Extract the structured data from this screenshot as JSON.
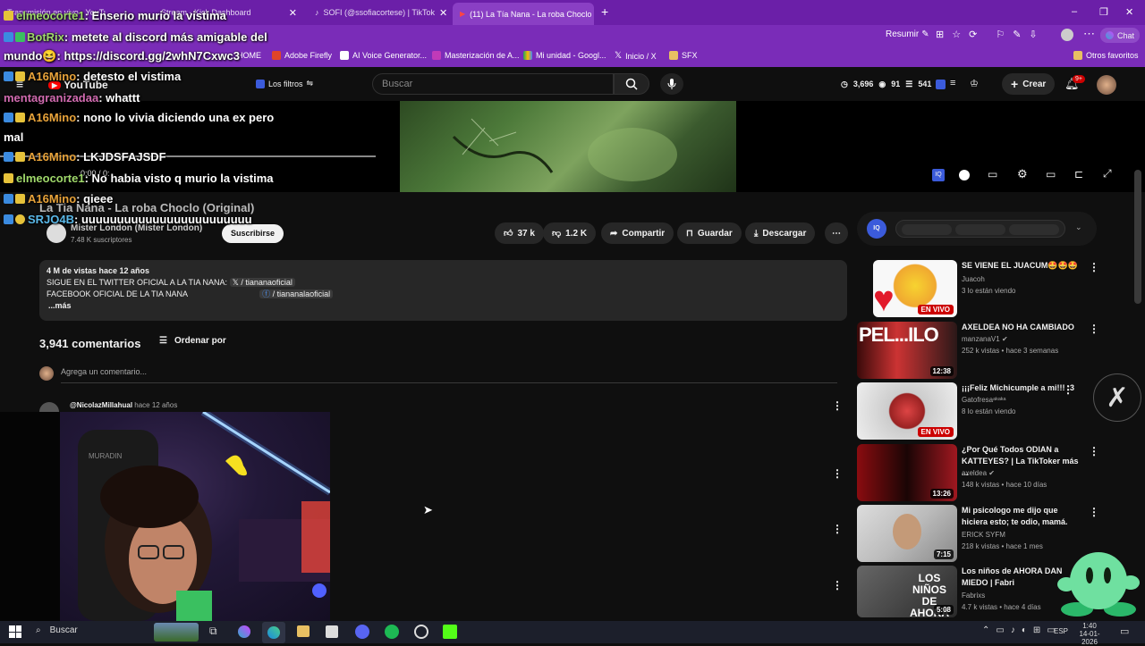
{
  "browser": {
    "tabs": [
      {
        "label": "Transmisión en vivo · YouTube St"
      },
      {
        "label": "Stream - Kick Dashboard"
      },
      {
        "label": "SOFI (@ssofiacortese) | TikTok"
      },
      {
        "label": "(11) La Tía Nana - La roba Choclo",
        "active": true
      }
    ],
    "new_tab": "+",
    "window_controls": [
      "–",
      "❐",
      "✕"
    ],
    "address_right": {
      "resume": "Resumir",
      "chat": "Chat"
    },
    "bookmarks": [
      "HOME",
      "Adobe Firefly",
      "AI Voice Generator...",
      "Masterización de A...",
      "Mi unidad - Googl...",
      "Inicio / X",
      "SFX"
    ],
    "other_bookmarks": "Otros favoritos"
  },
  "youtube": {
    "logo": "YouTube",
    "filters": "Los filtros",
    "search_placeholder": "Buscar",
    "stats": {
      "a": "3,696",
      "b": "91",
      "c": "541"
    },
    "create": "Crear",
    "notifications": "9+",
    "video_title": "La Tia Nana - La roba Choclo (Original)",
    "time": "0:00 / 0:",
    "channel": {
      "name": "Mister London (Mister London)",
      "subs": "7.48 K suscriptores",
      "subscribe": "Suscribirse"
    },
    "actions": {
      "likes": "37 k",
      "dislikes": "1.2 K",
      "share": "Compartir",
      "save": "Guardar",
      "download": "Descargar"
    },
    "description": {
      "line1": "4 M de vistas  hace 12 años",
      "line2_prefix": "SIGUE EN EL TWITTER OFICIAL A LA TIA NANA:",
      "line2_link": "/ tiananaoficial",
      "line3_prefix": "FACEBOOK OFICIAL DE LA TIA NANA",
      "line3_link": "/ tiananalaoficial",
      "more": "...más"
    },
    "comments": {
      "count": "3,941 comentarios",
      "sort": "Ordenar por",
      "placeholder": "Agrega un comentario...",
      "first_author": "@NicolazMillahual",
      "first_time": "hace 12 años"
    },
    "recommended": [
      {
        "title": "SE VIENE EL JUACUM🤩🤩🤩",
        "channel": "Juacoh",
        "meta": "3 lo están viendo",
        "badge": "EN VIVO",
        "live": true
      },
      {
        "title": "AXELDEA NO HA CAMBIADO",
        "channel": "manzanaV1",
        "meta": "252 k vistas • hace 3 semanas",
        "badge": "12:38"
      },
      {
        "title": "¡¡¡Feliz Michicumple a mi!!! :3",
        "channel": "Gatofresaᵃᵏᵃᵏᵃ",
        "meta": "8 lo están viendo",
        "badge": "EN VIVO",
        "live": true
      },
      {
        "title": "¿Por Qué Todos ODIAN a KATTEYES? | La TikToker más ...",
        "channel": "axeldea",
        "meta": "148 k vistas • hace 10 días",
        "badge": "13:26"
      },
      {
        "title": "Mi psicologo me dijo que hiciera esto; te odio, mamá.",
        "channel": "ERICK SYFM",
        "meta": "218 k vistas • hace 1 mes",
        "badge": "7:15"
      },
      {
        "title": "Los niños de AHORA DAN MIEDO | Fabri",
        "channel": "Fabrixs",
        "meta": "4.7 k vistas • hace 4 días",
        "badge": "5:08"
      }
    ],
    "thumb_text": {
      "t2": "PEL...ILO",
      "t6": "LOS NIÑOS DE AHORA"
    }
  },
  "chat_overlay": [
    {
      "name": "elmeocorte1",
      "text": ": Enserio murio la vistima"
    },
    {
      "name": "BotRix",
      "text": ": metete al discord más amigable del"
    },
    {
      "name": "",
      "text": "mundo😆: https://discord.gg/2whN7Cxwc3"
    },
    {
      "name": "A16Mino",
      "text": ": detesto el vistima"
    },
    {
      "name": "mentagranizadaa",
      "text": ": whattt"
    },
    {
      "name": "A16Mino",
      "text": ": nono lo vivia diciendo una ex pero"
    },
    {
      "name": "",
      "text": "mal"
    },
    {
      "name": "A16Mino",
      "text": ": LKJDSFAJSDF"
    },
    {
      "name": "elmeocorte1",
      "text": ": No habia visto q murio la vistima"
    },
    {
      "name": "A16Mino",
      "text": ": qieee"
    },
    {
      "name": "SRJO4B",
      "text": ": uuuuuuuuuuuuuuuuuuuuuuuu"
    }
  ],
  "taskbar": {
    "search": "Buscar",
    "lang": "ESP",
    "time": "1:40",
    "date": "14-01-2026"
  },
  "colors": {
    "accent": "#6b1fa8",
    "yt_bg": "#0f0f0f",
    "live": "#cc0000"
  }
}
